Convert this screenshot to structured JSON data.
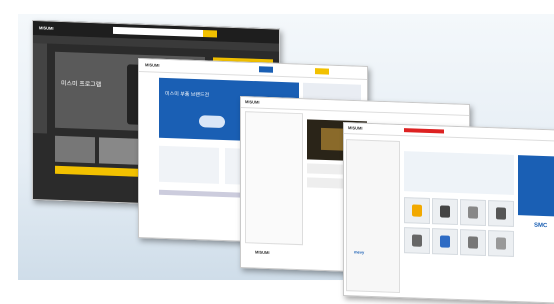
{
  "screens": [
    {
      "id": "screen-1",
      "logo": "MISUMI",
      "headline": "미스미 프로그램",
      "sub": "",
      "accent": "#f2c100"
    },
    {
      "id": "screen-2",
      "logo": "MISUMI",
      "headline": "미스미 부품 브랜드전",
      "sub": "",
      "accent": "#1a5fb4"
    },
    {
      "id": "screen-3",
      "logo": "MISUMI",
      "headline": "",
      "sub": "",
      "accent": "#1c1c1c"
    },
    {
      "id": "screen-4",
      "logo": "MISUMI",
      "headline": "",
      "sub": "",
      "accent": "#1a5fb4"
    }
  ],
  "footer": {
    "brand_s3": "MISUMI",
    "brand_s4": "mevy",
    "logo_smc": "SMC"
  },
  "colors": {
    "yellow": "#f2c100",
    "blue": "#1a5fb4",
    "dark": "#2b2b2b",
    "red": "#d22"
  }
}
